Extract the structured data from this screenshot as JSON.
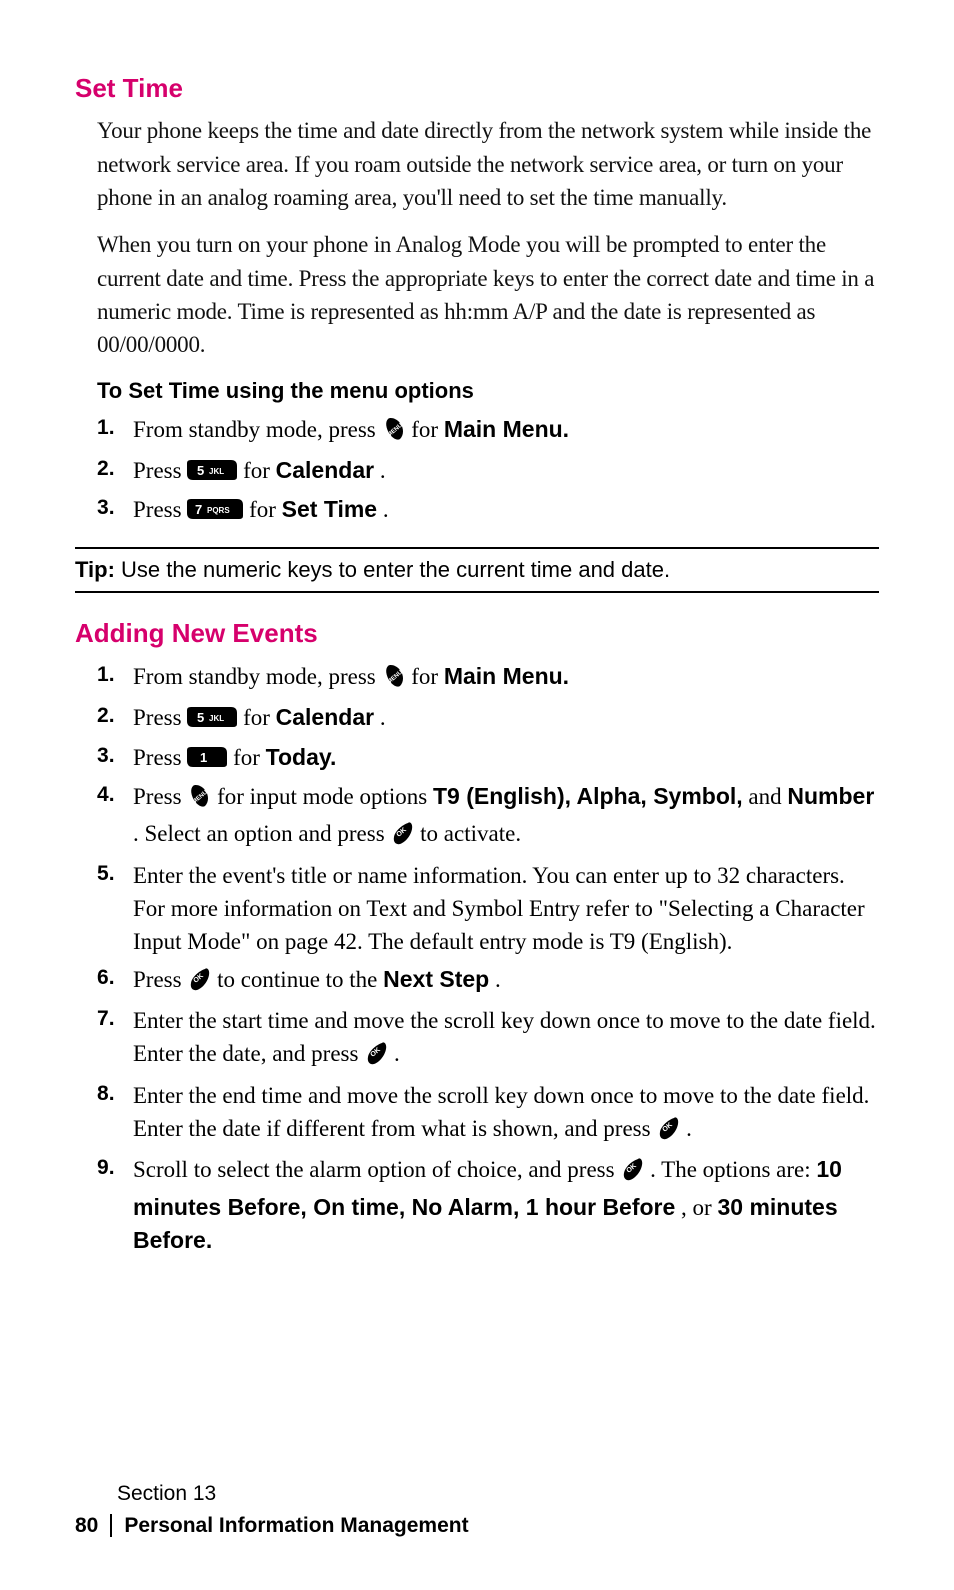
{
  "set_time": {
    "heading": "Set Time",
    "para1": "Your phone keeps the time and date directly from the network system while inside the network service area. If you roam outside the network service area, or turn on your phone in an analog roaming area, you'll need to set the time manually.",
    "para2": "When you turn on your phone in Analog Mode you will be prompted to enter the current date and time. Press the appropriate keys to enter the correct date and time in a numeric mode. Time is represented as hh:mm A/P and the date is represented as 00/00/0000.",
    "subhead": "To Set Time using the menu options",
    "step1_a": "From standby mode, press ",
    "step1_b": " for ",
    "step1_c": "Main Menu.",
    "step2_a": "Press ",
    "step2_b": " for ",
    "step2_c": "Calendar",
    "step2_d": ".",
    "step3_a": "Press ",
    "step3_b": " for ",
    "step3_c": "Set Time",
    "step3_d": "."
  },
  "tip": {
    "label": "Tip:",
    "text": " Use the numeric keys to enter the current time and date."
  },
  "add_events": {
    "heading": "Adding New Events",
    "s1_a": "From standby mode, press ",
    "s1_b": " for ",
    "s1_c": "Main Menu.",
    "s2_a": "Press ",
    "s2_b": " for ",
    "s2_c": "Calendar",
    "s2_d": ".",
    "s3_a": "Press ",
    "s3_b": " for ",
    "s3_c": "Today.",
    "s4_a": "Press ",
    "s4_b": " for input mode options ",
    "s4_c": "T9 (English), Alpha, Symbol,",
    "s4_d": " and ",
    "s4_e": "Number",
    "s4_f": ". Select an option and press ",
    "s4_g": " to activate.",
    "s5": "Enter the event's title or name information. You can enter up to 32 characters. For more information on Text and Symbol Entry refer to \"Selecting a Character Input Mode\" on page 42. The default entry mode is T9 (English).",
    "s6_a": "Press ",
    "s6_b": " to continue to the ",
    "s6_c": "Next Step",
    "s6_d": ".",
    "s7_a": "Enter the start time and move the scroll key down once to move to the date field. Enter the date, and press ",
    "s7_b": " .",
    "s8_a": "Enter the end time and move the scroll key down once to move to the date field. Enter the date if different from what is shown, and press ",
    "s8_b": " .",
    "s9_a": "Scroll to select the alarm option of choice, and press ",
    "s9_b": " . The options are: ",
    "s9_c": "10 minutes Before, On time, No Alarm, 1 hour Before",
    "s9_d": ", or ",
    "s9_e": "30 minutes Before."
  },
  "footer": {
    "section": "Section 13",
    "page": "80",
    "title": "Personal Information Management"
  }
}
